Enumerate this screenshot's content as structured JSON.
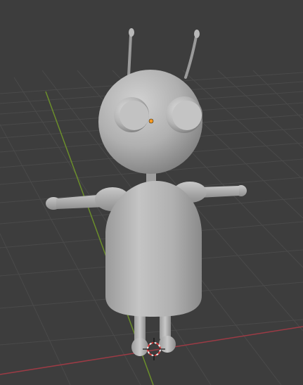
{
  "viewport": {
    "background": "#3d3d3d",
    "grid_color": "#4a4a4a",
    "axis_x_color": "#9c3b45",
    "axis_y_color": "#6b8e2b",
    "cursor_colors": [
      "#d63a3a",
      "#f0f0f0"
    ]
  },
  "selection": {
    "origin_color": "#f59a23"
  },
  "model": {
    "shade_light": "#c6c6c6",
    "shade_mid": "#a8a8a8",
    "shade_dark": "#7b7b7b"
  }
}
